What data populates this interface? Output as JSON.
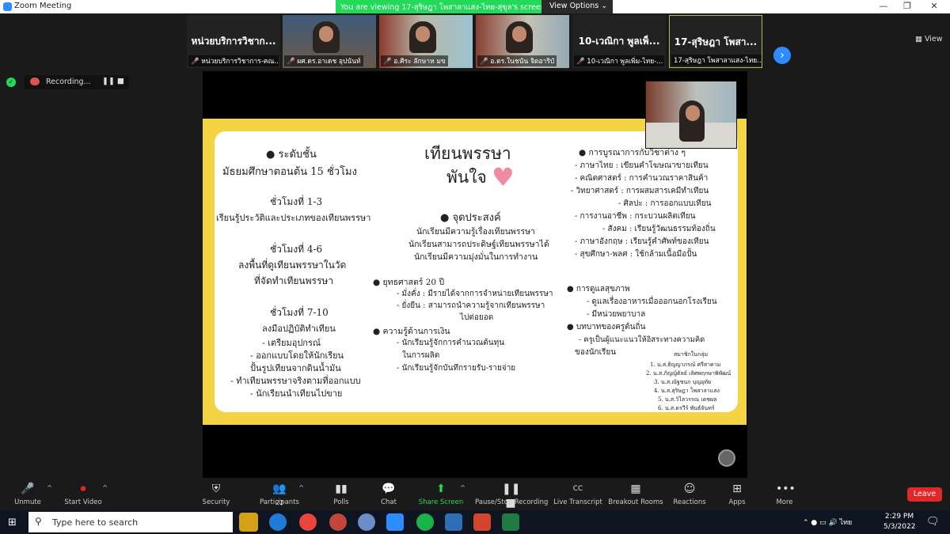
{
  "titlebar": {
    "title": "Zoom Meeting"
  },
  "banner": {
    "viewing": "You are viewing 17-สุริษฎา โพสาลาแสง-ไทย-สุขุล's screen",
    "options": "View Options ⌄"
  },
  "window_controls": {
    "min": "—",
    "max": "❐",
    "close": "✕"
  },
  "participants_strip": [
    {
      "name": "หน่วยบริการวิชาก...",
      "caption": "หน่วยบริการวิชาการ-คณ..."
    },
    {
      "name": "",
      "caption": "ผศ.ดร.อาเดช อุปนันท์"
    },
    {
      "name": "",
      "caption": "อ.ศิระ ลักษาห มข"
    },
    {
      "name": "",
      "caption": "อ.ดร.ในชนัน จิตอาริบั"
    },
    {
      "name": "10-เวณิกา พูลเพ็...",
      "caption": "10-เวณิกา พูลเพิ่ม-ไทย-..."
    },
    {
      "name": "17-สุริษฎา โพสา...",
      "caption": "17-สุริษฎา โพสาลาแสง-ไทย..."
    }
  ],
  "next_page": "›",
  "view_label": "View",
  "recording": {
    "label": "Recording...",
    "pause": "❚❚",
    "stop": "■"
  },
  "slide": {
    "title1": "เทียนพรรษา",
    "title2": "พันใจ",
    "left": [
      "● ระดับชั้น",
      "มัธยมศึกษาตอนต้น 15 ชั่วโมง",
      "ชั่วโมงที่ 1-3",
      "เรียนรู้ประวัติและประเภทของเทียนพรรษา",
      "ชั่วโมงที่ 4-6",
      "ลงพื้นที่ดูเทียนพรรษาในวัด",
      "ที่จัดทำเทียนพรรษา",
      "ชั่วโมงที่ 7-10",
      "ลงมือปฏิบัติทำเทียน",
      "- เตรียมอุปกรณ์",
      "- ออกแบบโดยให้นักเรียน",
      "ปั้นรูปเทียนจากดินน้ำมัน",
      "- ทำเทียนพรรษาจริงตามที่ออกแบบ",
      "- นักเรียนนำเทียนไปขาย"
    ],
    "middle": [
      "● จุดประสงค์",
      "นักเรียนมีความรู้เรื่องเทียนพรรษา",
      "นักเรียนสามารถประดิษฐ์เทียนพรรษาได้",
      "นักเรียนมีความมุ่งมั่นในการทำงาน",
      "● ยุทธศาสตร์ 20 ปี",
      "- มั่งคั่ง : มีรายได้จากการจำหน่ายเทียนพรรษา",
      "- ยั่งยืน : สามารถนำความรู้จากเทียนพรรษา",
      "ไปต่อยอด",
      "● ความรู้ด้านการเงิน",
      "- นักเรียนรู้จักการคำนวณต้นทุน",
      "ในการผลิต",
      "- นักเรียนรู้จักบันทึกรายรับ-รายจ่าย"
    ],
    "right": [
      "● การบูรณาการกับวิชาต่าง ๆ",
      "- ภาษาไทย : เขียนคำโฆษณาขายเทียน",
      "- คณิตศาสตร์ : การคำนวณราคาสินค้า",
      "- วิทยาศาสตร์ : การผสมสารเคมีทำเทียน",
      "- ศิลปะ : การออกแบบเทียน",
      "- การงานอาชีพ : กระบวนผลิตเทียน",
      "- สังคม : เรียนรู้วัฒนธรรมท้องถิ่น",
      "- ภาษาอังกฤษ : เรียนรู้คำศัพท์ของเทียน",
      "- สุขศึกษา-พลศ : ใช้กล้ามเนื้อมือปั้น",
      "● การดูแลสุขภาพ",
      "- ดูแลเรื่องอาหารเมื่อออกนอกโรงเรียน",
      "- มีหน่วยพยาบาล",
      "● บทบาทของครูต้นถิ่น",
      "- ครูเป็นผู้แนะแนวให้อิสระทางความคิด",
      "ของนักเรียน"
    ],
    "members_title": "สมาชิกในกลุ่ม",
    "members": [
      "1. น.ส.ธิญญาภรณ์ ศรีสาคาม",
      "2. น.ส.ภิญญ์ดัลย์ เลิศพฤกษาพิพัฒน์",
      "3. น.ส.ณัฐชนก บุญอุทัย",
      "4. น.ส.สุริษฎา โพสาลาแสง",
      "5. น.ส.วิไลวรรณ เดชผล",
      "6. น.ส.ดรวีร์ พันธ์จันทร์"
    ]
  },
  "toolbar": {
    "unmute": "Unmute",
    "start_video": "Start Video",
    "security": "Security",
    "participants": "Participants",
    "participants_count": "22",
    "polls": "Polls",
    "chat": "Chat",
    "share_screen": "Share Screen",
    "pause_recording": "Pause/Stop Recording",
    "live_transcript": "Live Transcript",
    "breakout": "Breakout Rooms",
    "reactions": "Reactions",
    "apps": "Apps",
    "more": "More",
    "leave": "Leave",
    "cc": "CC"
  },
  "taskbar": {
    "search_placeholder": "Type here to search",
    "lang": "ไทย",
    "time": "2:29 PM",
    "date": "5/3/2022"
  },
  "colors": {
    "slide_bg": "#f5d443",
    "zoom_blue": "#2d8cff",
    "green": "#23d959",
    "leave_red": "#e02828"
  }
}
